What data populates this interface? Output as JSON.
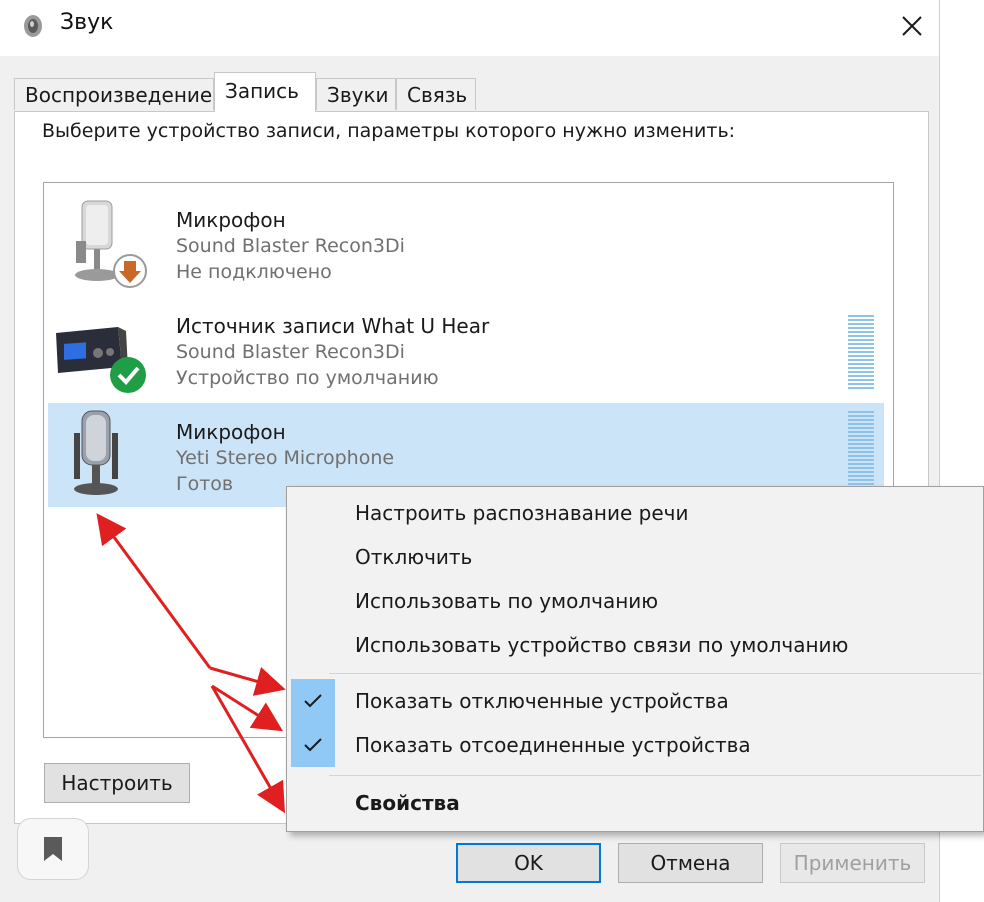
{
  "window": {
    "title": "Звук"
  },
  "tabs": [
    {
      "label": "Воспроизведение",
      "active": false
    },
    {
      "label": "Запись",
      "active": true
    },
    {
      "label": "Звуки",
      "active": false
    },
    {
      "label": "Связь",
      "active": false
    }
  ],
  "instruction": "Выберите устройство записи, параметры которого нужно изменить:",
  "devices": [
    {
      "name": "Микрофон",
      "driver": "Sound Blaster Recon3Di",
      "status": "Не подключено",
      "badge": "down-arrow-badge",
      "selected": false
    },
    {
      "name": "Источник записи What U Hear",
      "driver": "Sound Blaster Recon3Di",
      "status": "Устройство по умолчанию",
      "badge": "check-badge",
      "selected": false
    },
    {
      "name": "Микрофон",
      "driver": "Yeti Stereo Microphone",
      "status": "Готов",
      "badge": "",
      "selected": true
    }
  ],
  "buttons": {
    "configure": "Настроить",
    "ok": "OK",
    "cancel": "Отмена",
    "apply": "Применить"
  },
  "context_menu": {
    "items": [
      {
        "label": "Настроить распознавание речи",
        "checked": false
      },
      {
        "label": "Отключить",
        "checked": false
      },
      {
        "label": "Использовать по умолчанию",
        "checked": false
      },
      {
        "label": "Использовать устройство связи по умолчанию",
        "checked": false
      },
      {
        "label": "Показать отключенные устройства",
        "checked": true
      },
      {
        "label": "Показать отсоединенные устройства",
        "checked": true
      },
      {
        "label": "Свойства",
        "checked": false,
        "bold": true
      }
    ]
  },
  "colors": {
    "selection": "#cce4f7",
    "accent": "#0078d7",
    "annotation_arrow": "#e02020",
    "check_highlight": "#90c8f6"
  }
}
